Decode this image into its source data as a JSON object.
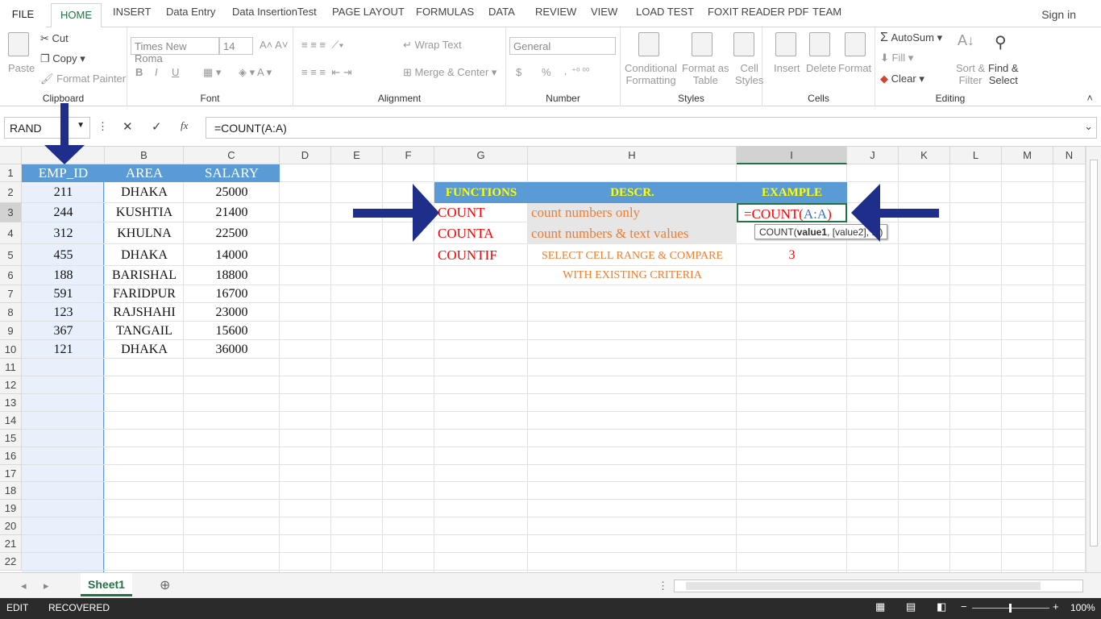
{
  "tabs": [
    "FILE",
    "HOME",
    "INSERT",
    "Data Entry",
    "Data InsertionTest",
    "PAGE LAYOUT",
    "FORMULAS",
    "DATA",
    "REVIEW",
    "VIEW",
    "LOAD TEST",
    "FOXIT READER PDF",
    "TEAM"
  ],
  "signin": "Sign in",
  "clipboard": {
    "paste": "Paste",
    "cut": "Cut",
    "copy": "Copy",
    "format_painter": "Format Painter",
    "label": "Clipboard"
  },
  "font": {
    "name": "Times New Roma",
    "size": "14",
    "label": "Font",
    "bold": "B",
    "italic": "I",
    "underline": "U"
  },
  "alignment": {
    "wrap": "Wrap Text",
    "merge": "Merge & Center",
    "label": "Alignment"
  },
  "number": {
    "format": "General",
    "label": "Number",
    "currency": "$",
    "percent": "%"
  },
  "styles": {
    "cond1": "Conditional",
    "cond2": "Formatting",
    "fmt1": "Format as",
    "fmt2": "Table",
    "cell1": "Cell",
    "cell2": "Styles",
    "label": "Styles"
  },
  "cells": {
    "insert": "Insert",
    "delete": "Delete",
    "format": "Format",
    "label": "Cells"
  },
  "editing": {
    "autosum": "AutoSum",
    "fill": "Fill",
    "clear": "Clear",
    "sort1": "Sort &",
    "sort2": "Filter",
    "find1": "Find &",
    "find2": "Select",
    "label": "Editing"
  },
  "namebox": "RAND",
  "formula": "=COUNT(A:A)",
  "fx": "fx",
  "columns": [
    "A",
    "B",
    "C",
    "D",
    "E",
    "F",
    "G",
    "H",
    "I",
    "J",
    "K",
    "L",
    "M",
    "N"
  ],
  "rows": [
    "1",
    "2",
    "3",
    "4",
    "5",
    "6",
    "7",
    "8",
    "9",
    "10",
    "11",
    "12",
    "13",
    "14",
    "15",
    "16",
    "17",
    "18",
    "19",
    "20",
    "21",
    "22"
  ],
  "table_headers": [
    "EMP_ID",
    "AREA",
    "SALARY"
  ],
  "table_rows": [
    [
      "211",
      "DHAKA",
      "25000"
    ],
    [
      "244",
      "KUSHTIA",
      "21400"
    ],
    [
      "312",
      "KHULNA",
      "22500"
    ],
    [
      "455",
      "DHAKA",
      "14000"
    ],
    [
      "188",
      "BARISHAL",
      "18800"
    ],
    [
      "591",
      "FARIDPUR",
      "16700"
    ],
    [
      "123",
      "RAJSHAHI",
      "23000"
    ],
    [
      "367",
      "TANGAIL",
      "15600"
    ],
    [
      "121",
      "DHAKA",
      "36000"
    ]
  ],
  "func_headers": [
    "FUNCTIONS",
    "DESCR.",
    "EXAMPLE"
  ],
  "functions": [
    {
      "name": "COUNT",
      "desc": "count numbers only",
      "example_pre": "=COUNT(",
      "example_ref": "A:A",
      "example_post": ")"
    },
    {
      "name": "COUNTA",
      "desc": "count numbers & text values",
      "example": ""
    },
    {
      "name": "COUNTIF",
      "desc1": "SELECT CELL RANGE  & COMPARE",
      "desc2": "WITH EXISTING CRITERIA",
      "example": "3"
    }
  ],
  "tooltip": {
    "pre": "COUNT(",
    "bold": "value1",
    "post": ", [value2], ...)"
  },
  "sheet_tab": "Sheet1",
  "status": {
    "mode": "EDIT",
    "recovered": "RECOVERED",
    "zoom": "100%"
  },
  "colors": {
    "excel_green": "#217346",
    "header_blue": "#5b9bd5",
    "func_yellow": "#ffff00",
    "func_red": "#ff0000",
    "desc_orange": "#ed7d31",
    "arrow_navy": "#1f2e8a",
    "colA_bg": "#e8f0fb"
  }
}
